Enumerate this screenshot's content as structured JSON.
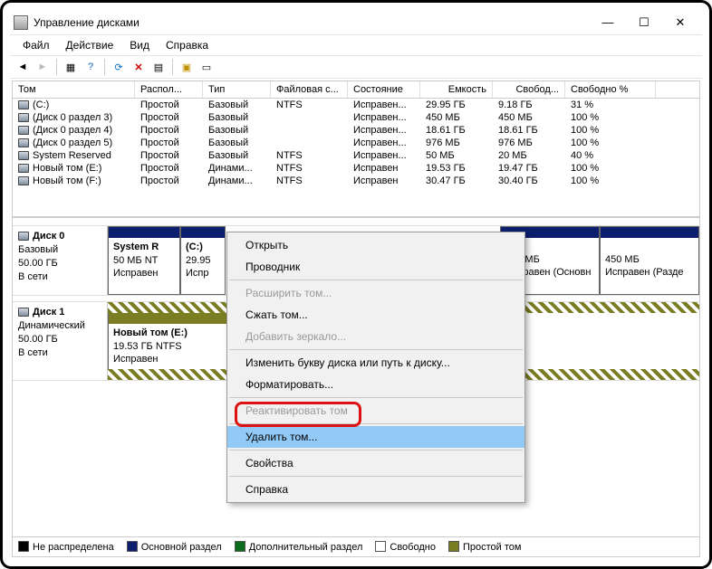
{
  "window": {
    "title": "Управление дисками"
  },
  "menu": [
    "Файл",
    "Действие",
    "Вид",
    "Справка"
  ],
  "columns": [
    "Том",
    "Распол...",
    "Тип",
    "Файловая с...",
    "Состояние",
    "Емкость",
    "Свобод...",
    "Свободно %"
  ],
  "volumes": [
    {
      "name": "(C:)",
      "layout": "Простой",
      "type": "Базовый",
      "fs": "NTFS",
      "state": "Исправен...",
      "cap": "29.95 ГБ",
      "free": "9.18 ГБ",
      "pct": "31 %"
    },
    {
      "name": "(Диск 0 раздел 3)",
      "layout": "Простой",
      "type": "Базовый",
      "fs": "",
      "state": "Исправен...",
      "cap": "450 МБ",
      "free": "450 МБ",
      "pct": "100 %"
    },
    {
      "name": "(Диск 0 раздел 4)",
      "layout": "Простой",
      "type": "Базовый",
      "fs": "",
      "state": "Исправен...",
      "cap": "18.61 ГБ",
      "free": "18.61 ГБ",
      "pct": "100 %"
    },
    {
      "name": "(Диск 0 раздел 5)",
      "layout": "Простой",
      "type": "Базовый",
      "fs": "",
      "state": "Исправен...",
      "cap": "976 МБ",
      "free": "976 МБ",
      "pct": "100 %"
    },
    {
      "name": "System Reserved",
      "layout": "Простой",
      "type": "Базовый",
      "fs": "NTFS",
      "state": "Исправен...",
      "cap": "50 МБ",
      "free": "20 МБ",
      "pct": "40 %"
    },
    {
      "name": "Новый том (E:)",
      "layout": "Простой",
      "type": "Динами...",
      "fs": "NTFS",
      "state": "Исправен",
      "cap": "19.53 ГБ",
      "free": "19.47 ГБ",
      "pct": "100 %"
    },
    {
      "name": "Новый том (F:)",
      "layout": "Простой",
      "type": "Динами...",
      "fs": "NTFS",
      "state": "Исправен",
      "cap": "30.47 ГБ",
      "free": "30.40 ГБ",
      "pct": "100 %"
    }
  ],
  "disk0": {
    "label": "Диск 0",
    "type": "Базовый",
    "size": "50.00 ГБ",
    "status": "В сети",
    "parts": [
      {
        "title": "System R",
        "sub1": "50 МБ NT",
        "sub2": "Исправен"
      },
      {
        "title": "(C:)",
        "sub1": "29.95",
        "sub2": "Испр"
      },
      {
        "title": "",
        "sub1": "976 МБ",
        "sub2": "Исправен (Основн"
      },
      {
        "title": "",
        "sub1": "450 МБ",
        "sub2": "Исправен (Разде"
      }
    ]
  },
  "disk1": {
    "label": "Диск 1",
    "type": "Динамический",
    "size": "50.00 ГБ",
    "status": "В сети",
    "parts": [
      {
        "title": "Новый том  (E:)",
        "sub1": "19.53 ГБ NTFS",
        "sub2": "Исправен"
      }
    ]
  },
  "context_menu": {
    "items": [
      {
        "label": "Открыть",
        "enabled": true
      },
      {
        "label": "Проводник",
        "enabled": true
      },
      {
        "label": "Расширить том...",
        "enabled": false,
        "sep_before": true
      },
      {
        "label": "Сжать том...",
        "enabled": true
      },
      {
        "label": "Добавить зеркало...",
        "enabled": false
      },
      {
        "label": "Изменить букву диска или путь к диску...",
        "enabled": true,
        "sep_before": true
      },
      {
        "label": "Форматировать...",
        "enabled": true
      },
      {
        "label": "Реактивировать том",
        "enabled": false,
        "sep_before": true
      },
      {
        "label": "Удалить том...",
        "enabled": true,
        "selected": true,
        "sep_before": true
      },
      {
        "label": "Свойства",
        "enabled": true,
        "sep_before": true
      },
      {
        "label": "Справка",
        "enabled": true,
        "sep_before": true
      }
    ]
  },
  "legend": {
    "unalloc": "Не распределена",
    "primary": "Основной раздел",
    "extended": "Дополнительный раздел",
    "free": "Свободно",
    "simple": "Простой том"
  }
}
